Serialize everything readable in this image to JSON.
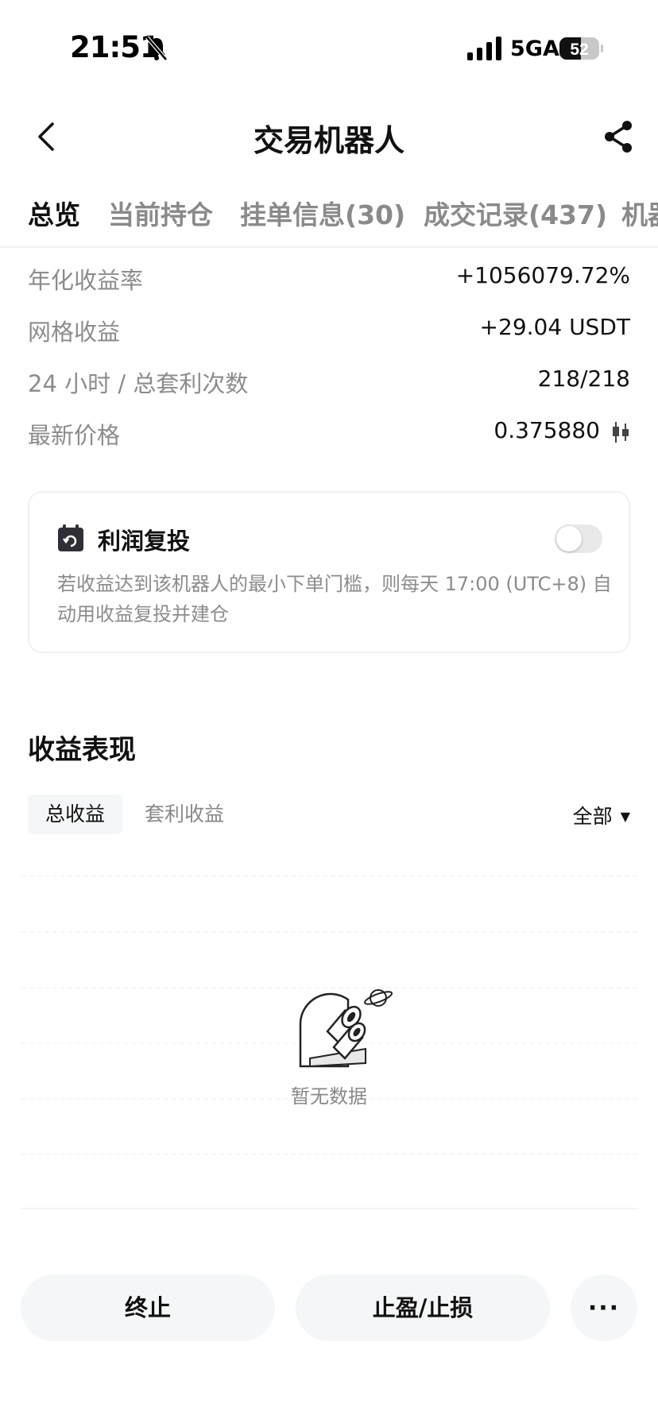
{
  "status_bar": {
    "time": "21:51",
    "network": "5GA",
    "battery": "52"
  },
  "nav": {
    "title": "交易机器人"
  },
  "tabs": [
    {
      "label": "总览",
      "active": true
    },
    {
      "label": "当前持仓",
      "active": false
    },
    {
      "label": "挂单信息(30)",
      "active": false
    },
    {
      "label": "成交记录(437)",
      "active": false
    },
    {
      "label": "机器",
      "active": false
    }
  ],
  "stats": [
    {
      "label": "年化收益率",
      "value": "+1056079.72%"
    },
    {
      "label": "网格收益",
      "value": "+29.04 USDT"
    },
    {
      "label": "24 小时 / 总套利次数",
      "value": "218/218"
    },
    {
      "label": "最新价格",
      "value": "0.375880"
    }
  ],
  "reinvest_card": {
    "title": "利润复投",
    "description": "若收益达到该机器人的最小下单门槛，则每天 17:00 (UTC+8) 自动用收益复投并建仓",
    "toggle_on": false
  },
  "performance": {
    "section_title": "收益表现",
    "sub_tabs": [
      {
        "label": "总收益",
        "active": true
      },
      {
        "label": "套利收益",
        "active": false
      }
    ],
    "filter": "全部",
    "empty_text": "暂无数据"
  },
  "actions": {
    "stop": "终止",
    "tp_sl": "止盈/止损",
    "more": "···"
  },
  "colors": {
    "text_primary": "#111111",
    "text_secondary": "#8c8c8c",
    "button_bg": "#f5f6f7",
    "toggle_off": "#e9e9e9"
  }
}
